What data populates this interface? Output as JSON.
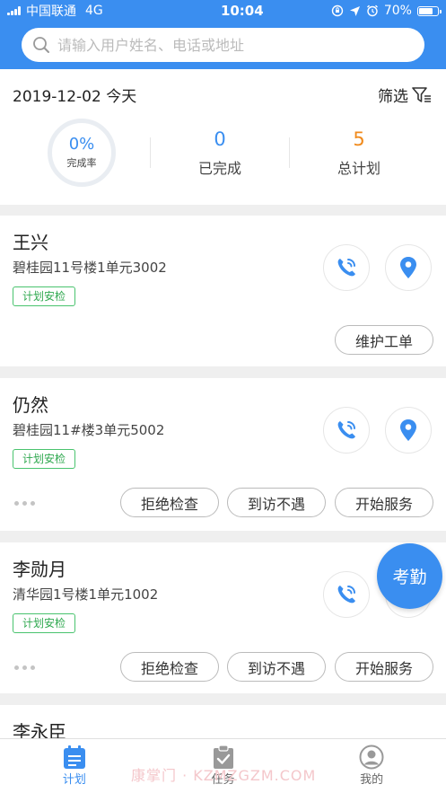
{
  "status_bar": {
    "carrier": "中国联通",
    "network": "4G",
    "time": "10:04",
    "battery": "70%"
  },
  "search": {
    "placeholder": "请输入用户姓名、电话或地址"
  },
  "summary": {
    "date": "2019-12-02 今天",
    "filter_label": "筛选",
    "completion_value": "0%",
    "completion_label": "完成率",
    "completed_value": "0",
    "completed_label": "已完成",
    "total_value": "5",
    "total_label": "总计划"
  },
  "cards": [
    {
      "name": "王兴",
      "address": "碧桂园11号楼1单元3002",
      "tag": "计划安检",
      "buttons": [
        "维护工单"
      ]
    },
    {
      "name": "仍然",
      "address": "碧桂园11#楼3单元5002",
      "tag": "计划安检",
      "buttons": [
        "拒绝检查",
        "到访不遇",
        "开始服务"
      ]
    },
    {
      "name": "李勋月",
      "address": "清华园1号楼1单元1002",
      "tag": "计划安检",
      "buttons": [
        "拒绝检查",
        "到访不遇",
        "开始服务"
      ]
    },
    {
      "name": "李永臣"
    }
  ],
  "fab_label": "考勤",
  "tabs": [
    {
      "label": "计划"
    },
    {
      "label": "任务"
    },
    {
      "label": "我的"
    }
  ],
  "watermark": "康掌门 · KZMZGZM.COM",
  "colors": {
    "primary": "#3a8ef0",
    "orange": "#f08a1c",
    "tag_green": "#2fa84f"
  }
}
